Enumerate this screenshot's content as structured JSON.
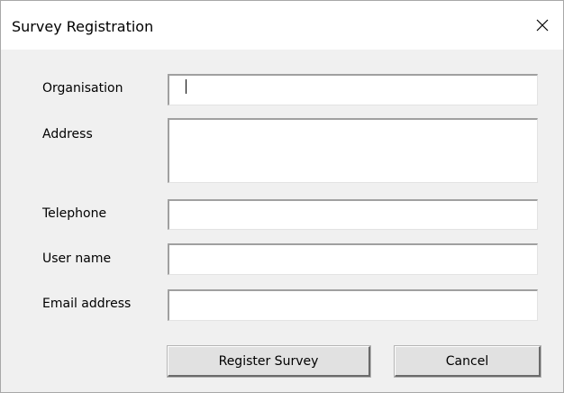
{
  "window": {
    "title": "Survey Registration",
    "close_icon": "close-x-icon"
  },
  "form": {
    "organisation": {
      "label": "Organisation",
      "value": ""
    },
    "address": {
      "label": "Address",
      "value": ""
    },
    "telephone": {
      "label": "Telephone",
      "value": ""
    },
    "user_name": {
      "label": "User name",
      "value": ""
    },
    "email_address": {
      "label": "Email address",
      "value": ""
    }
  },
  "buttons": {
    "register_label": "Register Survey",
    "cancel_label": "Cancel"
  },
  "colors": {
    "titlebar_bg": "#ffffff",
    "client_bg": "#f0f0f0",
    "button_face": "#e1e1e1",
    "field_bg": "#ffffff"
  }
}
